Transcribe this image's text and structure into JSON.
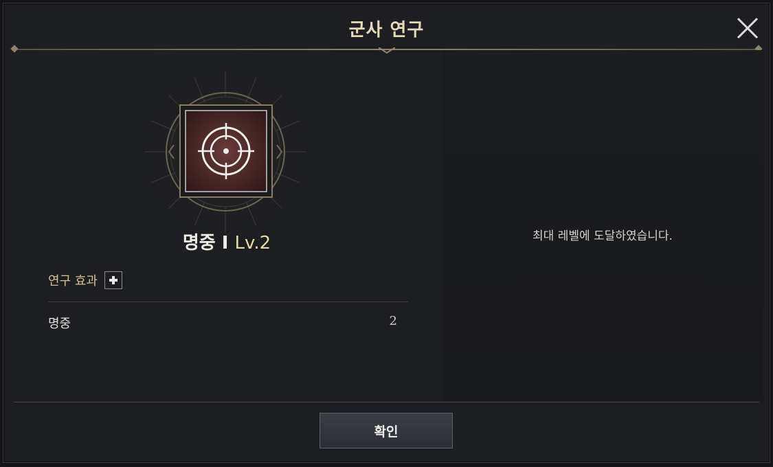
{
  "dialog": {
    "title": "군사 연구"
  },
  "skill": {
    "name": "명중 I",
    "level": "Lv.2",
    "icon": "crosshair-icon"
  },
  "effects": {
    "header": "연구 효과",
    "rows": [
      {
        "label": "명중",
        "value": "2"
      }
    ]
  },
  "right": {
    "message": "최대 레벨에 도달하였습니다."
  },
  "footer": {
    "confirm_label": "확인"
  },
  "colors": {
    "accent_gold": "#e6d9b6",
    "panel_bg": "#1d1e21",
    "button_bg": "#2f333a"
  }
}
